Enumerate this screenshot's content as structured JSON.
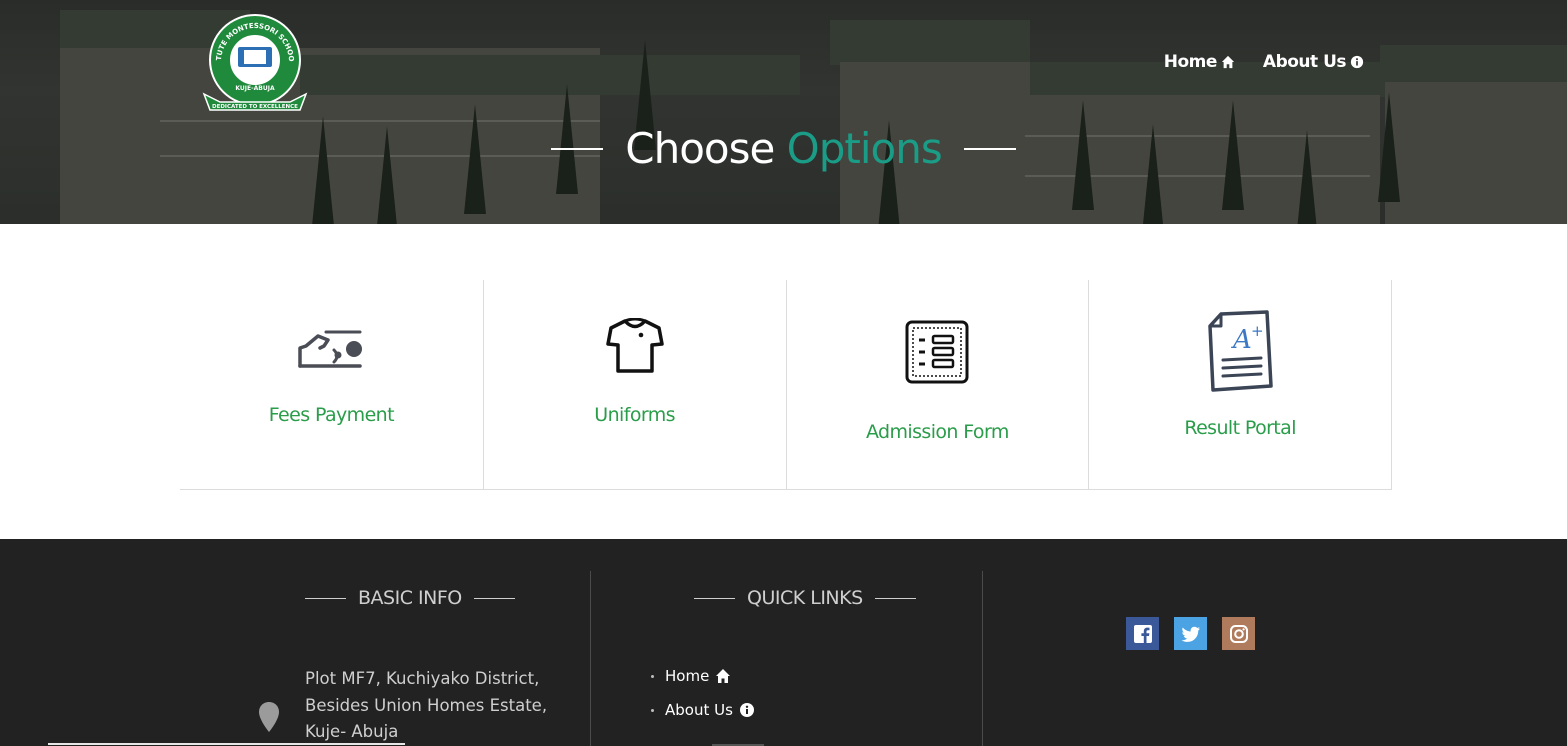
{
  "nav": {
    "home_label": "Home",
    "about_label": "About Us"
  },
  "hero": {
    "title_main": "Choose",
    "title_accent": "Options",
    "accent_color": "#1a9c86"
  },
  "logo": {
    "ring_text": "ASTUTE MONTESSORI SCHOOLS",
    "location_text": "KUJE-ABUJA",
    "banner_text": "DEDICATED TO EXCELLENCE"
  },
  "options": [
    {
      "label": "Fees Payment",
      "icon": "hand-cash-icon"
    },
    {
      "label": "Uniforms",
      "icon": "shirt-icon"
    },
    {
      "label": "Admission Form",
      "icon": "form-icon"
    },
    {
      "label": "Result Portal",
      "icon": "graded-paper-icon"
    }
  ],
  "footer": {
    "basic_info_title": "BASIC INFO",
    "quick_links_title": "QUICK LINKS",
    "address_lines": [
      "Plot MF7, Kuchiyako District,",
      "Besides Union Homes Estate,",
      "Kuje- Abuja"
    ],
    "quick_links": [
      {
        "label": "Home",
        "icon": "home-icon"
      },
      {
        "label": "About Us",
        "icon": "info-icon"
      }
    ],
    "social": [
      {
        "name": "facebook",
        "color": "#3b5998"
      },
      {
        "name": "twitter",
        "color": "#4ba3e3"
      },
      {
        "name": "instagram",
        "color": "#b07a5c"
      }
    ]
  }
}
